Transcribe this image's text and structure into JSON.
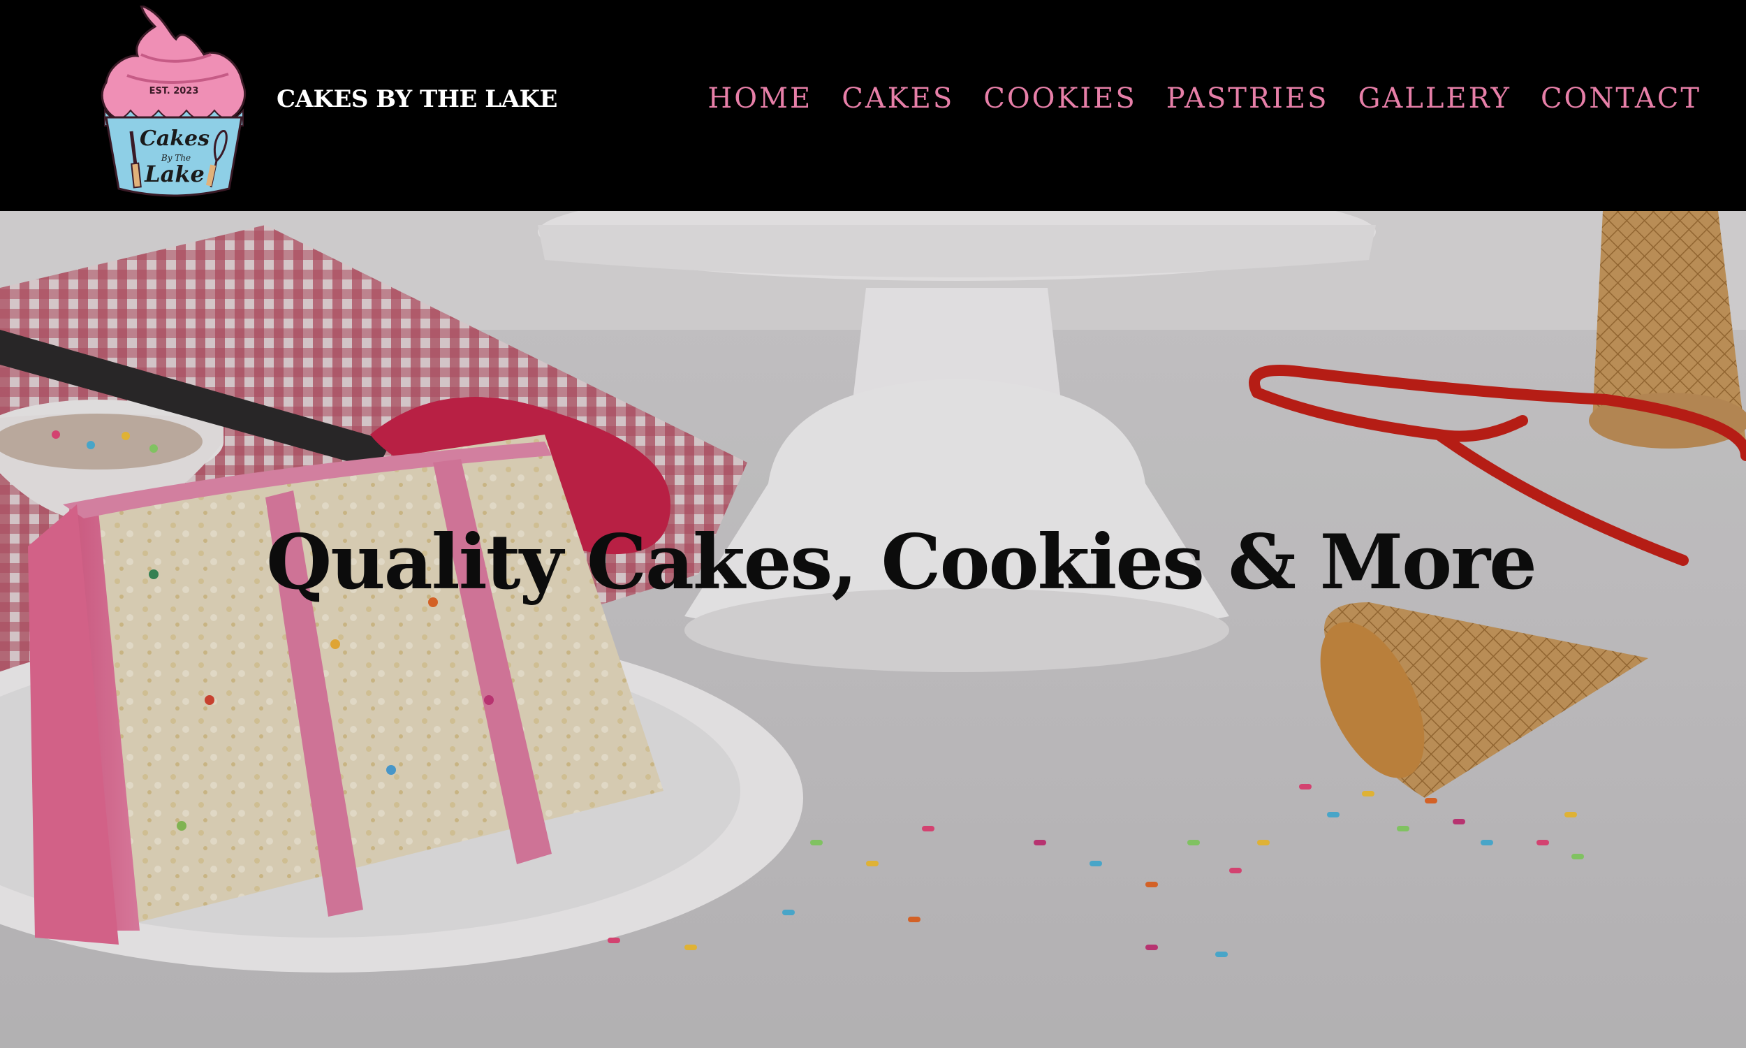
{
  "brand": {
    "name": "CAKES BY THE LAKE",
    "logo_est": "EST. 2023",
    "logo_line1": "Cakes",
    "logo_line2": "By The",
    "logo_line3": "Lake"
  },
  "nav": {
    "items": [
      "HOME",
      "CAKES",
      "COOKIES",
      "PASTRIES",
      "GALLERY",
      "CONTACT"
    ]
  },
  "hero": {
    "title": "Quality Cakes, Cookies & More"
  },
  "colors": {
    "header_bg": "#000000",
    "nav_text": "#e77fa8",
    "brand_text": "#ffffff",
    "hero_title": "#0c0c0c",
    "frosting_pink": "#e6799e",
    "cupcake_blue": "#8ecfe6"
  }
}
